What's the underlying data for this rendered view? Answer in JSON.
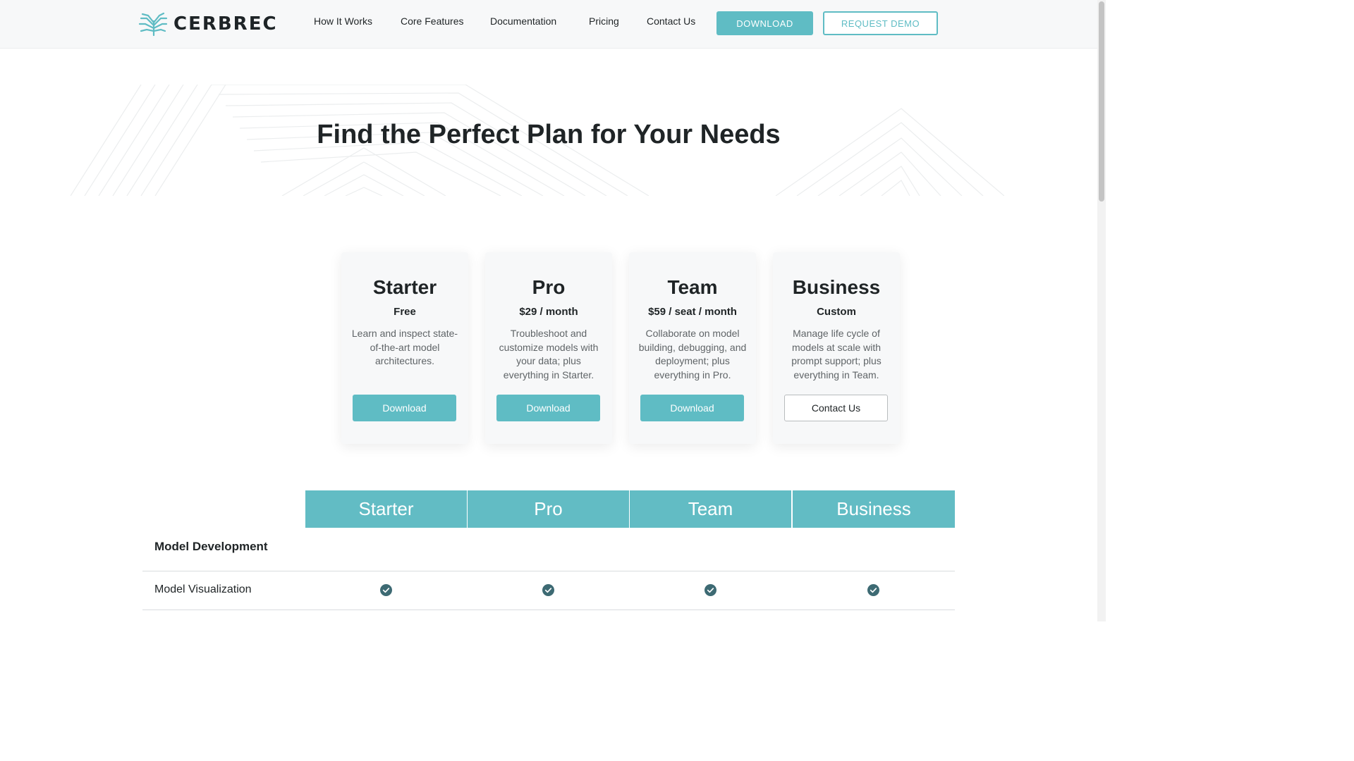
{
  "brand": {
    "name": "CERBREC",
    "accent_color": "#5fbcc4",
    "logo_icon": "circuit-tree-icon"
  },
  "nav": {
    "items": [
      "How It Works",
      "Core Features",
      "Documentation",
      "Pricing",
      "Contact Us"
    ],
    "download_label": "DOWNLOAD",
    "demo_label": "REQUEST DEMO"
  },
  "hero": {
    "title": "Find the Perfect Plan for Your Needs"
  },
  "plans": [
    {
      "name": "Starter",
      "price": "Free",
      "description": "Learn and inspect state-of-the-art model architectures.",
      "button": "Download"
    },
    {
      "name": "Pro",
      "price": "$29 / month",
      "description": "Troubleshoot and customize models with your data; plus everything in Starter.",
      "button": "Download"
    },
    {
      "name": "Team",
      "price": "$59 / seat / month",
      "description": "Collaborate on model building, debugging, and deployment; plus everything in Pro.",
      "button": "Download"
    },
    {
      "name": "Business",
      "price": "Custom",
      "description": "Manage life cycle of models at scale with prompt support; plus everything in Team.",
      "button": "Contact Us"
    }
  ],
  "comparison": {
    "tiers": [
      "Starter",
      "Pro",
      "Team",
      "Business"
    ],
    "section": "Model Development",
    "features": [
      {
        "name": "Model Visualization",
        "included": [
          true,
          true,
          true,
          true
        ],
        "icon": "check-circle-icon"
      }
    ]
  }
}
